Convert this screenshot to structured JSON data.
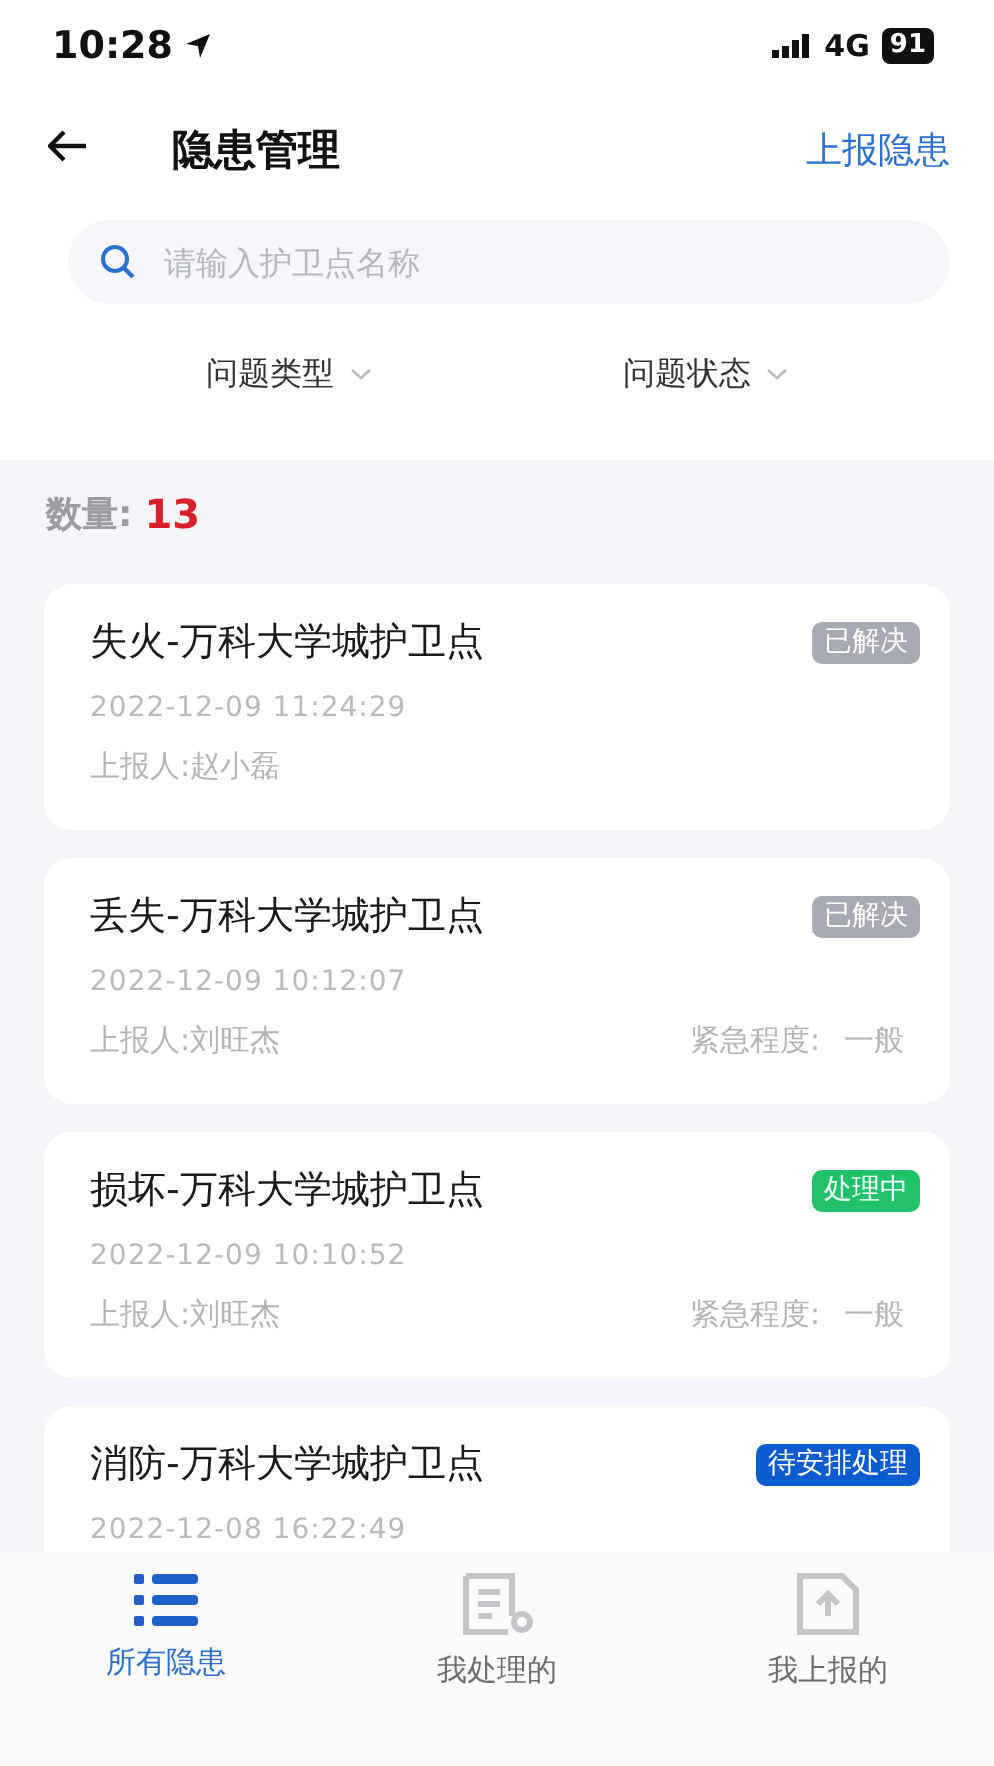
{
  "status_bar": {
    "time": "10:28",
    "network": "4G",
    "battery": "91"
  },
  "header": {
    "title": "隐患管理",
    "action": "上报隐患"
  },
  "search": {
    "placeholder": "请输入护卫点名称"
  },
  "filters": [
    {
      "label": "问题类型"
    },
    {
      "label": "问题状态"
    }
  ],
  "count": {
    "label": "数量:",
    "value": "13"
  },
  "issues": [
    {
      "title": "失火-万科大学城护卫点",
      "status": "已解决",
      "color": "#a7aab2",
      "time": "2022-12-09 11:24:29",
      "reporter": "上报人:赵小磊"
    },
    {
      "title": "丢失-万科大学城护卫点",
      "status": "已解决",
      "color": "#a7aab2",
      "time": "2022-12-09 10:12:07",
      "reporter": "上报人:刘旺杰",
      "urgency_label": "紧急程度:",
      "urgency": "一般"
    },
    {
      "title": "损坏-万科大学城护卫点",
      "status": "处理中",
      "color": "#1fc16b",
      "time": "2022-12-09 10:10:52",
      "reporter": "上报人:刘旺杰",
      "urgency_label": "紧急程度:",
      "urgency": "一般"
    },
    {
      "title": "消防-万科大学城护卫点",
      "status": "待安排处理",
      "color": "#0d5bd0",
      "time": "2022-12-08 16:22:49"
    }
  ],
  "tabs": [
    {
      "label": "所有隐患",
      "selected": true,
      "kind": "list"
    },
    {
      "label": "我处理的",
      "selected": false,
      "kind": "doc"
    },
    {
      "label": "我上报的",
      "selected": false,
      "kind": "upload"
    }
  ]
}
